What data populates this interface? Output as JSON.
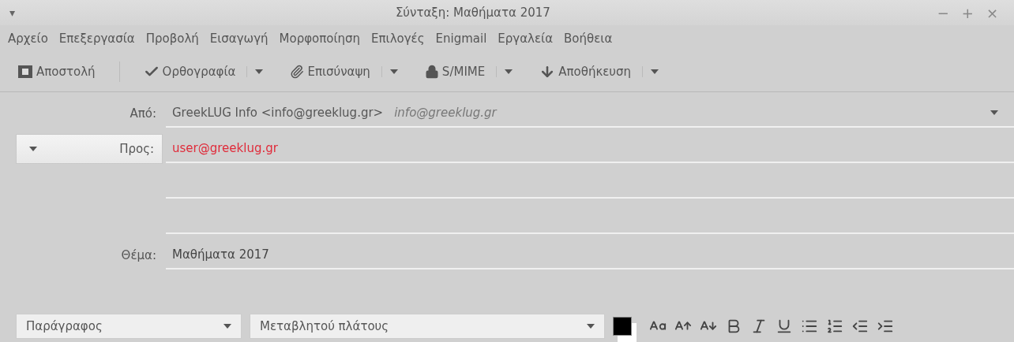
{
  "window": {
    "title": "Σύνταξη: Μαθήματα 2017",
    "menu_glyph": "▾",
    "controls": [
      "−",
      "+",
      "×"
    ]
  },
  "menu": [
    "Αρχείο",
    "Επεξεργασία",
    "Προβολή",
    "Εισαγωγή",
    "Μορφοποίηση",
    "Επιλογές",
    "Enigmail",
    "Εργαλεία",
    "Βοήθεια"
  ],
  "toolbar": [
    {
      "label": "Αποστολή",
      "kind": "send",
      "dropdown": false
    },
    {
      "label": "Ορθογραφία",
      "kind": "spelling",
      "dropdown": true
    },
    {
      "label": "Επισύναψη",
      "kind": "attach",
      "dropdown": true
    },
    {
      "label": "S/MIME",
      "kind": "security",
      "dropdown": true
    },
    {
      "label": "Αποθήκευση",
      "kind": "save",
      "dropdown": true
    }
  ],
  "from": {
    "label": "Από:",
    "value": "GreekLUG Info <info@greeklug.gr>",
    "placeholder": "info@greeklug.gr"
  },
  "recipient": {
    "type": "Προς:",
    "address": "user@greeklug.gr"
  },
  "subject": {
    "label": "Θέμα:",
    "value": "Μαθήματα 2017"
  },
  "format_bar": {
    "paragraph": "Παράγραφος",
    "font": "Μεταβλητού πλάτους"
  }
}
